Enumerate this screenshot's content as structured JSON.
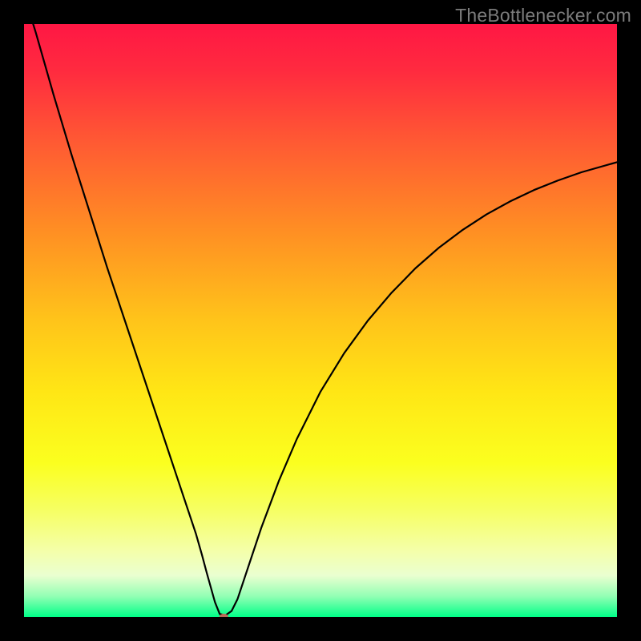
{
  "watermark": "TheBottlenecker.com",
  "chart_data": {
    "type": "line",
    "title": "",
    "xlabel": "",
    "ylabel": "",
    "xlim": [
      0,
      100
    ],
    "ylim": [
      0,
      100
    ],
    "background_gradient": {
      "stops": [
        {
          "offset": 0.0,
          "color": "#ff1744"
        },
        {
          "offset": 0.08,
          "color": "#ff2b3f"
        },
        {
          "offset": 0.2,
          "color": "#ff5a33"
        },
        {
          "offset": 0.35,
          "color": "#ff8f23"
        },
        {
          "offset": 0.5,
          "color": "#ffc41a"
        },
        {
          "offset": 0.62,
          "color": "#ffe615"
        },
        {
          "offset": 0.74,
          "color": "#fbff1f"
        },
        {
          "offset": 0.82,
          "color": "#f6ff63"
        },
        {
          "offset": 0.89,
          "color": "#f4ffab"
        },
        {
          "offset": 0.93,
          "color": "#eaffd0"
        },
        {
          "offset": 0.965,
          "color": "#93ffb4"
        },
        {
          "offset": 1.0,
          "color": "#00ff88"
        }
      ]
    },
    "series": [
      {
        "name": "bottleneck-curve",
        "color": "#000000",
        "stroke_width": 2.2,
        "x": [
          0.0,
          2.0,
          5.0,
          8.0,
          11.0,
          14.0,
          17.0,
          20.0,
          22.0,
          24.0,
          26.0,
          27.5,
          29.0,
          30.0,
          30.8,
          31.5,
          32.2,
          33.0,
          34.0,
          35.0,
          36.0,
          38.0,
          40.0,
          43.0,
          46.0,
          50.0,
          54.0,
          58.0,
          62.0,
          66.0,
          70.0,
          74.0,
          78.0,
          82.0,
          86.0,
          90.0,
          94.0,
          100.0
        ],
        "y": [
          105.0,
          98.5,
          88.0,
          78.0,
          68.5,
          59.0,
          50.0,
          41.0,
          35.0,
          29.0,
          23.0,
          18.5,
          14.0,
          10.5,
          7.5,
          5.0,
          2.5,
          0.5,
          0.3,
          1.0,
          3.0,
          9.0,
          15.0,
          23.0,
          30.0,
          38.0,
          44.5,
          50.0,
          54.7,
          58.8,
          62.3,
          65.3,
          67.9,
          70.1,
          72.0,
          73.6,
          75.0,
          76.7
        ]
      }
    ],
    "marker": {
      "name": "optimal-marker",
      "x": 33.7,
      "y": 0.0,
      "rx": 5.6,
      "ry": 4.1,
      "fill": "#bb6a58"
    }
  }
}
